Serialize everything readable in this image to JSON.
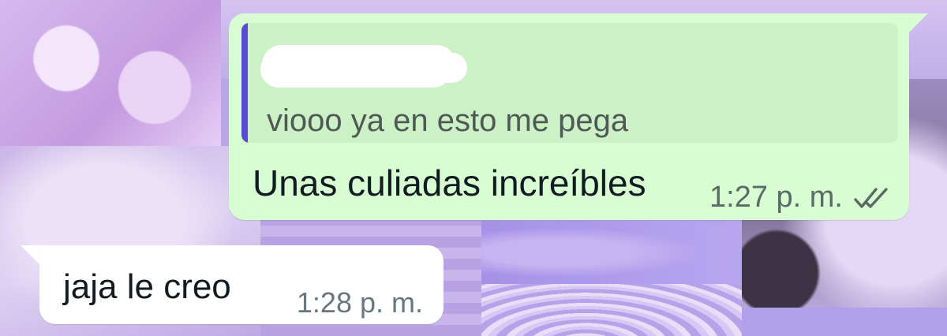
{
  "messages": {
    "outgoing": {
      "quoted_text": "viooo ya en esto me pega",
      "text": "Unas culiadas increíbles",
      "time": "1:27 p. m.",
      "status_icon": "double-check-icon"
    },
    "incoming": {
      "text": "jaja le creo",
      "time": "1:28 p. m."
    }
  },
  "colors": {
    "outgoing_bubble": "#d9fdd3",
    "quote_background": "#cdf1c6",
    "quote_accent": "#5b4ad3",
    "incoming_bubble": "#ffffff",
    "meta_text": "#667781"
  }
}
